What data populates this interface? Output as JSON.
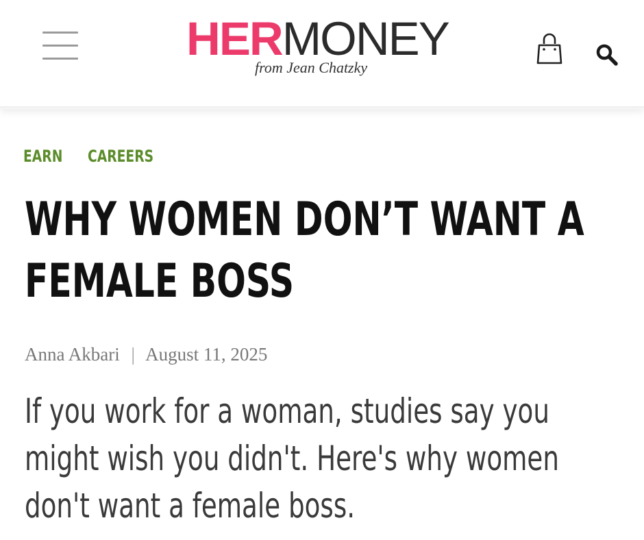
{
  "header": {
    "logo": {
      "her": "HER",
      "money": "MONEY",
      "tagline": "from Jean Chatzky",
      "brand_color": "#ec3a6b",
      "dark_color": "#2b2b2b"
    },
    "icons": {
      "menu": "hamburger-menu-icon",
      "cart": "shopping-bag-icon",
      "search": "search-icon"
    }
  },
  "article": {
    "categories": [
      {
        "label": "EARN"
      },
      {
        "label": "CAREERS"
      }
    ],
    "category_color": "#5b8c2a",
    "title_lines": [
      "WHY WOMEN DON’T WANT A",
      "FEMALE BOSS"
    ],
    "byline": {
      "author": "Anna Akbari",
      "separator": "|",
      "date": "August 11, 2025"
    },
    "excerpt_lines": [
      "If you work for a woman, studies say you",
      "might wish you didn't. Here's why women",
      "don't want a female boss."
    ]
  }
}
